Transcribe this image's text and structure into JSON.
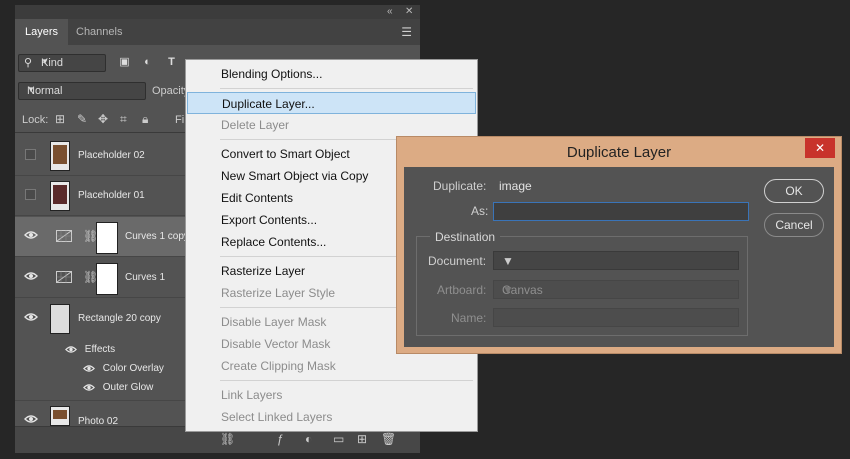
{
  "panel": {
    "tabs": [
      {
        "label": "Layers"
      },
      {
        "label": "Channels"
      }
    ],
    "filter_kind": "Kind",
    "blend_mode": "Normal",
    "opacity_label": "Opacity",
    "lock_label": "Lock:",
    "fill_label": "Fi",
    "layers": [
      {
        "name": "Placeholder 02",
        "visible": false
      },
      {
        "name": "Placeholder 01",
        "visible": false
      },
      {
        "name": "Curves 1 copy",
        "visible": true,
        "selected": true
      },
      {
        "name": "Curves 1",
        "visible": true
      },
      {
        "name": "Rectangle 20 copy",
        "visible": true
      },
      {
        "name": "Photo 02",
        "visible": true
      }
    ],
    "effects": {
      "label": "Effects",
      "items": [
        "Color Overlay",
        "Outer Glow"
      ]
    }
  },
  "context_menu": {
    "items": [
      {
        "label": "Blending Options...",
        "disabled": false
      },
      {
        "label": "Duplicate Layer...",
        "disabled": false,
        "highlighted": true
      },
      {
        "label": "Delete Layer",
        "disabled": true
      },
      {
        "label": "Convert to Smart Object",
        "disabled": false
      },
      {
        "label": "New Smart Object via Copy",
        "disabled": false
      },
      {
        "label": "Edit Contents",
        "disabled": false
      },
      {
        "label": "Export Contents...",
        "disabled": false
      },
      {
        "label": "Replace Contents...",
        "disabled": false
      },
      {
        "label": "Rasterize Layer",
        "disabled": false
      },
      {
        "label": "Rasterize Layer Style",
        "disabled": true
      },
      {
        "label": "Disable Layer Mask",
        "disabled": true
      },
      {
        "label": "Disable Vector Mask",
        "disabled": true
      },
      {
        "label": "Create Clipping Mask",
        "disabled": true
      },
      {
        "label": "Link Layers",
        "disabled": true
      },
      {
        "label": "Select Linked Layers",
        "disabled": true
      }
    ]
  },
  "dialog": {
    "title": "Duplicate Layer",
    "duplicate_label": "Duplicate:",
    "duplicate_value": "image",
    "as_label": "As:",
    "as_value": "",
    "destination_label": "Destination",
    "document_label": "Document:",
    "document_value": "",
    "artboard_label": "Artboard:",
    "artboard_value": "Canvas",
    "name_label": "Name:",
    "name_value": "",
    "ok_label": "OK",
    "cancel_label": "Cancel"
  },
  "colors": {
    "menu_highlight": "#cde4f7",
    "dialog_frame": "#dcab84",
    "close_button": "#c8332b"
  }
}
